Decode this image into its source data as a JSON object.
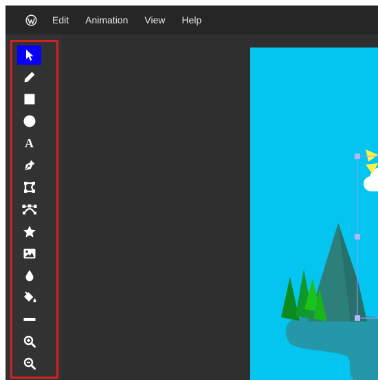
{
  "menubar": {
    "logo_icon": "wordpress-logo-icon",
    "items": [
      "Edit",
      "Animation",
      "View",
      "Help"
    ]
  },
  "toolbar": {
    "active_tool": "select",
    "highlight_color": "#d32222",
    "tools": [
      {
        "id": "select",
        "icon": "cursor-arrow-icon"
      },
      {
        "id": "pencil",
        "icon": "pencil-icon"
      },
      {
        "id": "rectangle",
        "icon": "square-icon"
      },
      {
        "id": "ellipse",
        "icon": "circle-icon"
      },
      {
        "id": "text",
        "icon": "text-a-icon",
        "glyph": "A"
      },
      {
        "id": "pen",
        "icon": "pen-nib-icon"
      },
      {
        "id": "transform",
        "icon": "transform-shape-icon"
      },
      {
        "id": "bezier",
        "icon": "bezier-curve-icon"
      },
      {
        "id": "star",
        "icon": "star-icon"
      },
      {
        "id": "image",
        "icon": "image-icon"
      },
      {
        "id": "eyedropper",
        "icon": "droplet-icon"
      },
      {
        "id": "fill",
        "icon": "paint-bucket-icon"
      },
      {
        "id": "line",
        "icon": "line-icon"
      },
      {
        "id": "zoom-in",
        "icon": "zoom-in-icon"
      },
      {
        "id": "zoom-out",
        "icon": "zoom-out-icon"
      }
    ]
  },
  "canvas": {
    "background_color": "#03c5ef",
    "scene": "mountain landscape with trees, lake, sun and cloud"
  }
}
